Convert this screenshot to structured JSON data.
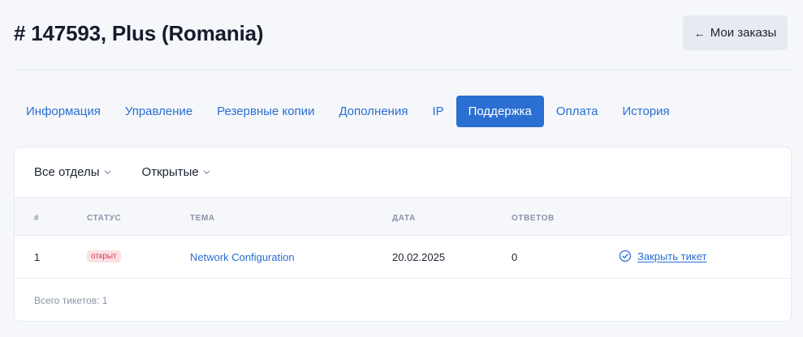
{
  "page": {
    "title": "# 147593, Plus (Romania)",
    "back_button": {
      "icon": "arrow-left-icon",
      "label": "Мои заказы"
    }
  },
  "tabs": [
    {
      "label": "Информация",
      "active": false
    },
    {
      "label": "Управление",
      "active": false
    },
    {
      "label": "Резервные копии",
      "active": false
    },
    {
      "label": "Дополнения",
      "active": false
    },
    {
      "label": "IP",
      "active": false
    },
    {
      "label": "Поддержка",
      "active": true
    },
    {
      "label": "Оплата",
      "active": false
    },
    {
      "label": "История",
      "active": false
    }
  ],
  "filters": {
    "department": "Все отделы",
    "status": "Открытые"
  },
  "table": {
    "columns": [
      "#",
      "СТАТУС",
      "ТЕМА",
      "ДАТА",
      "ОТВЕТОВ"
    ],
    "rows": [
      {
        "id": "1",
        "status": "открыт",
        "subject": "Network Configuration",
        "date": "20.02.2025",
        "replies": "0",
        "action": "Закрыть тикет"
      }
    ]
  },
  "footer": {
    "total": "Всего тикетов: 1"
  },
  "colors": {
    "accent": "#2a6fd1",
    "status_open_bg": "#fbe1e5",
    "status_open_text": "#d73a52",
    "page_bg": "#f5f7fb"
  }
}
